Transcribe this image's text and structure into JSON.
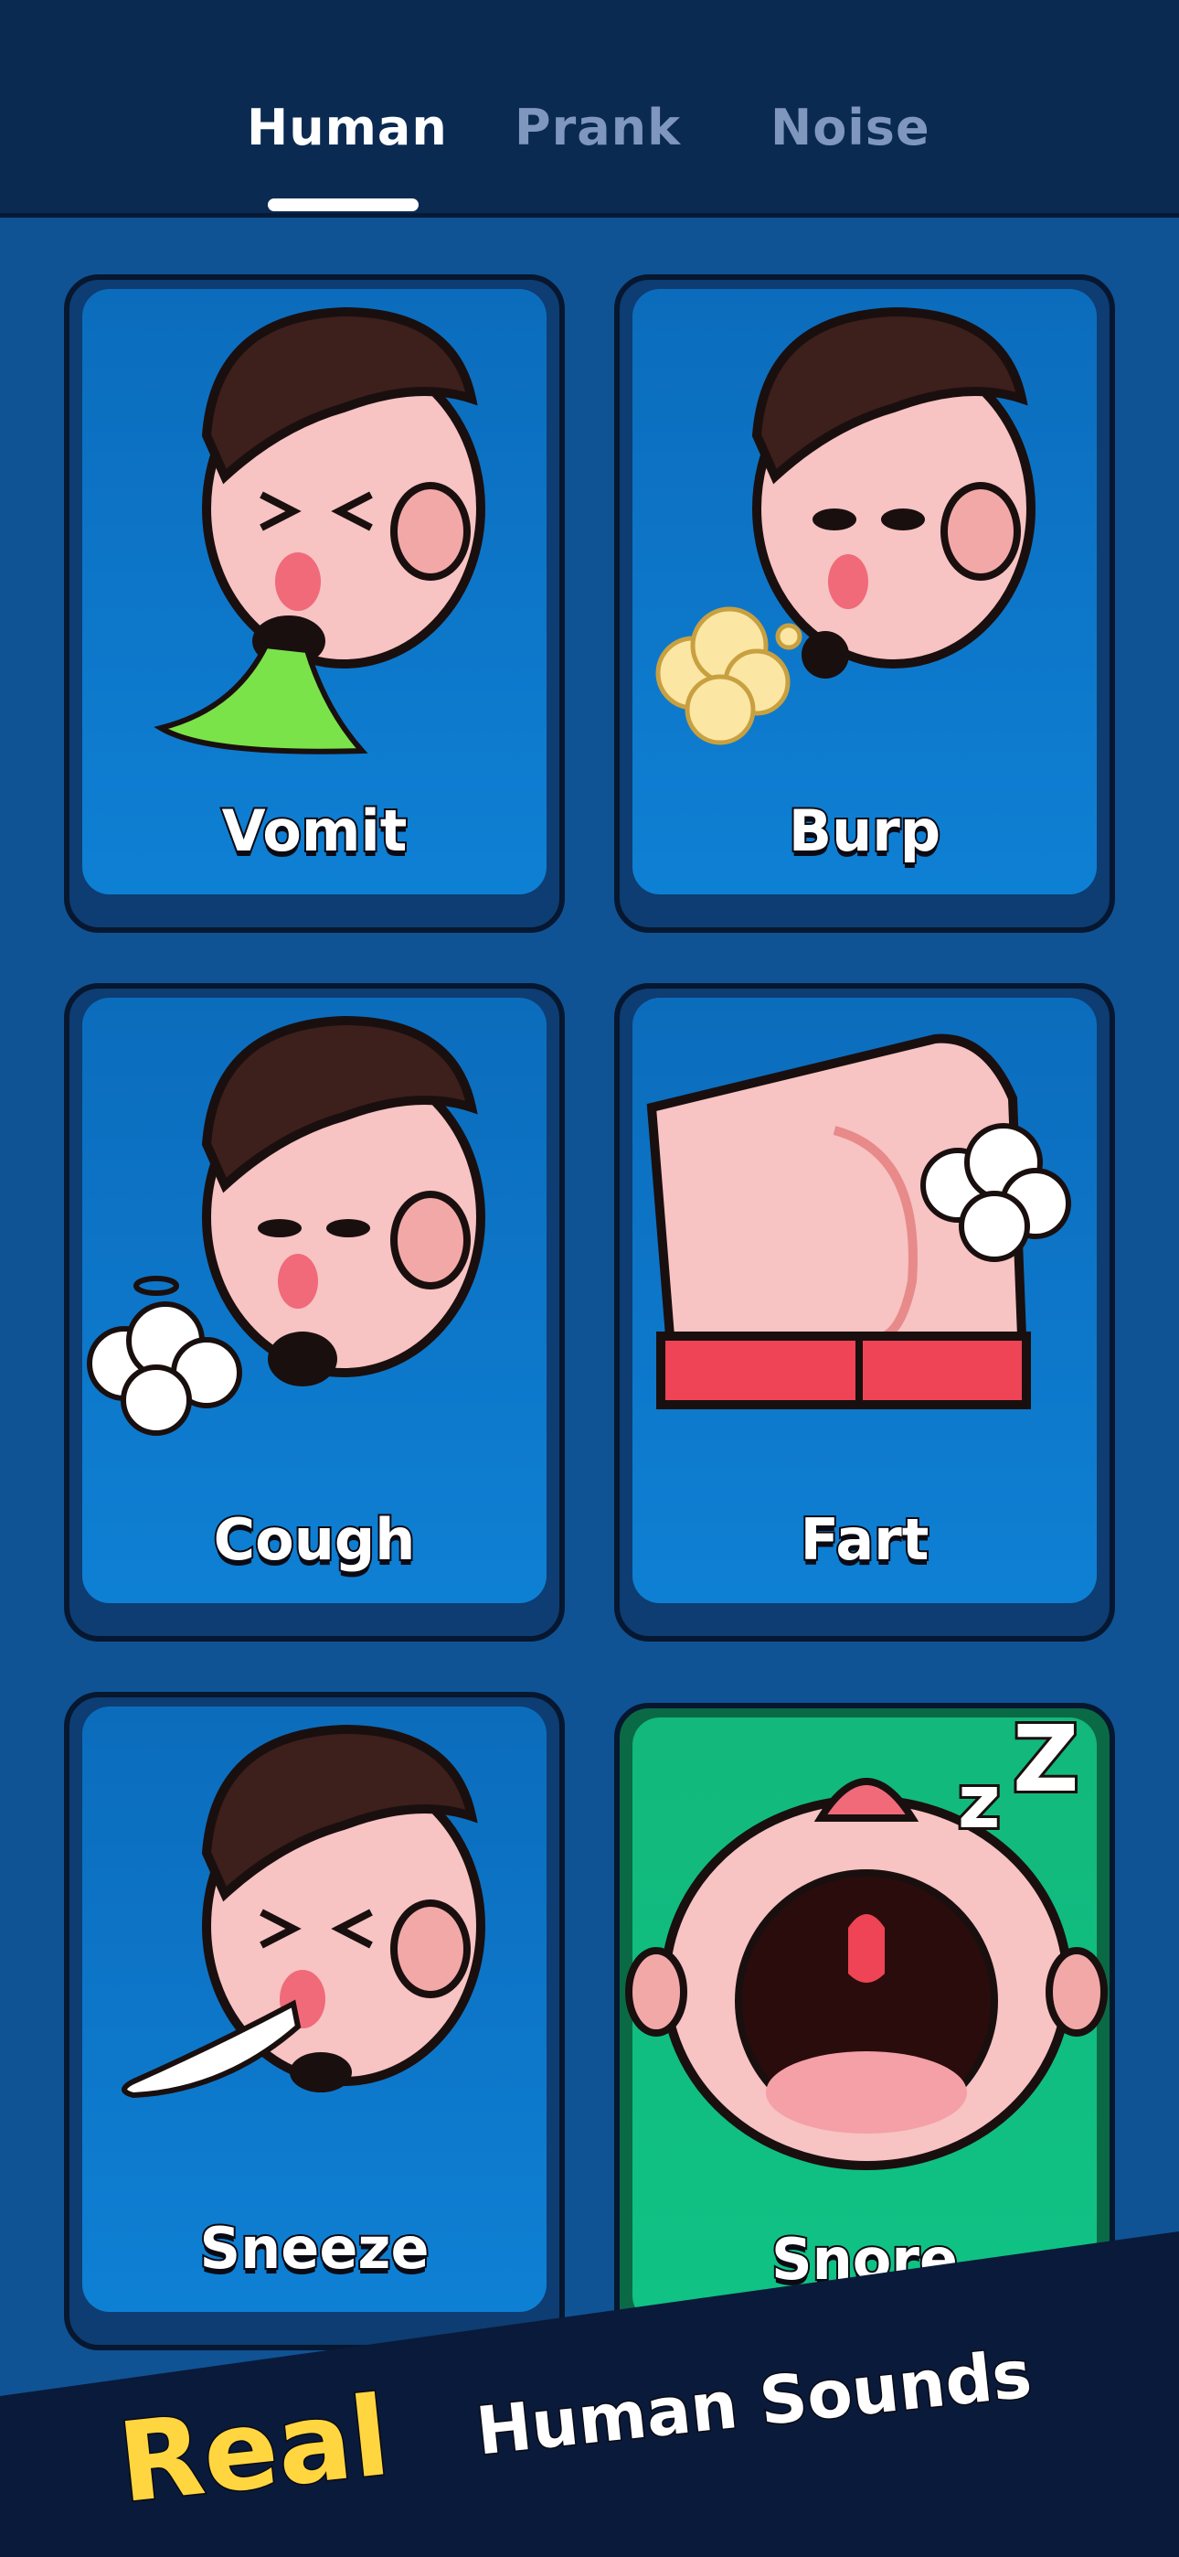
{
  "tabs": [
    {
      "label": "Human",
      "active": true
    },
    {
      "label": "Prank",
      "active": false
    },
    {
      "label": "Noise",
      "active": false
    }
  ],
  "cards": [
    {
      "label": "Vomit",
      "icon": "vomit-face-icon",
      "color": "#0e7bcf"
    },
    {
      "label": "Burp",
      "icon": "burp-face-icon",
      "color": "#0e7bcf"
    },
    {
      "label": "Cough",
      "icon": "cough-face-icon",
      "color": "#0e7bcf"
    },
    {
      "label": "Fart",
      "icon": "fart-butt-icon",
      "color": "#0e7bcf"
    },
    {
      "label": "Sneeze",
      "icon": "sneeze-face-icon",
      "color": "#0e7bcf"
    },
    {
      "label": "Snore",
      "icon": "snore-face-icon",
      "color": "#12c086"
    }
  ],
  "banner": {
    "real": "Real",
    "subtitle": "Human Sounds",
    "accent_color": "#ffd640"
  }
}
